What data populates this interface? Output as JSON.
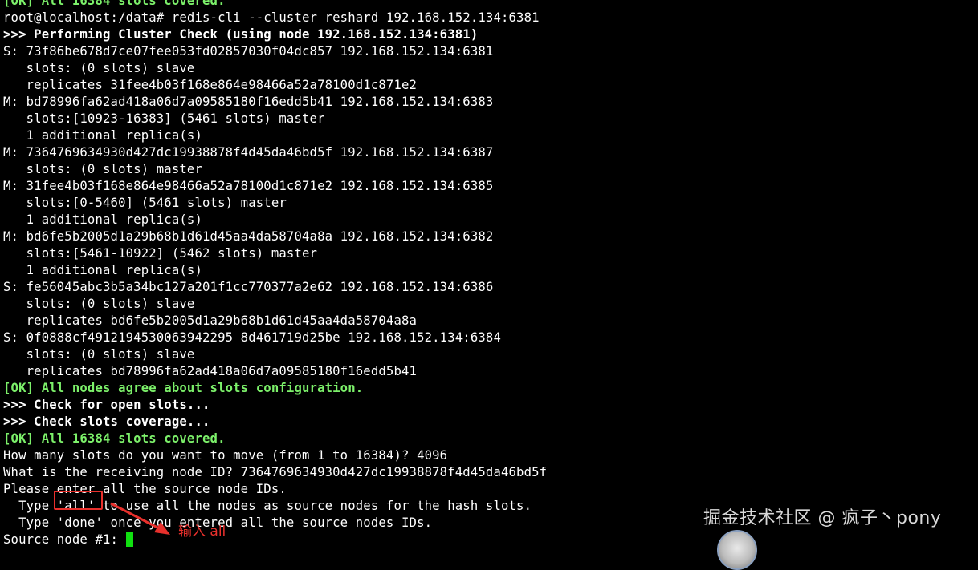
{
  "terminal": {
    "lines": [
      {
        "text": "[OK] All 16384 slots covered.",
        "style": "green"
      },
      {
        "text": "root@localhost:/data# redis-cli --cluster reshard 192.168.152.134:6381",
        "style": "normal"
      },
      {
        "text": ">>> Performing Cluster Check (using node 192.168.152.134:6381)",
        "style": "bold"
      },
      {
        "text": "S: 73f86be678d7ce07fee053fd02857030f04dc857 192.168.152.134:6381",
        "style": "normal"
      },
      {
        "text": "   slots: (0 slots) slave",
        "style": "normal"
      },
      {
        "text": "   replicates 31fee4b03f168e864e98466a52a78100d1c871e2",
        "style": "normal"
      },
      {
        "text": "M: bd78996fa62ad418a06d7a09585180f16edd5b41 192.168.152.134:6383",
        "style": "normal"
      },
      {
        "text": "   slots:[10923-16383] (5461 slots) master",
        "style": "normal"
      },
      {
        "text": "   1 additional replica(s)",
        "style": "normal"
      },
      {
        "text": "M: 7364769634930d427dc19938878f4d45da46bd5f 192.168.152.134:6387",
        "style": "normal"
      },
      {
        "text": "   slots: (0 slots) master",
        "style": "normal"
      },
      {
        "text": "M: 31fee4b03f168e864e98466a52a78100d1c871e2 192.168.152.134:6385",
        "style": "normal"
      },
      {
        "text": "   slots:[0-5460] (5461 slots) master",
        "style": "normal"
      },
      {
        "text": "   1 additional replica(s)",
        "style": "normal"
      },
      {
        "text": "M: bd6fe5b2005d1a29b68b1d61d45aa4da58704a8a 192.168.152.134:6382",
        "style": "normal"
      },
      {
        "text": "   slots:[5461-10922] (5462 slots) master",
        "style": "normal"
      },
      {
        "text": "   1 additional replica(s)",
        "style": "normal"
      },
      {
        "text": "S: fe56045abc3b5a34bc127a201f1cc770377a2e62 192.168.152.134:6386",
        "style": "normal"
      },
      {
        "text": "   slots: (0 slots) slave",
        "style": "normal"
      },
      {
        "text": "   replicates bd6fe5b2005d1a29b68b1d61d45aa4da58704a8a",
        "style": "normal"
      },
      {
        "text": "S: 0f0888cf4912194530063942295 8d461719d25be 192.168.152.134:6384",
        "style": "normal"
      },
      {
        "text": "   slots: (0 slots) slave",
        "style": "normal"
      },
      {
        "text": "   replicates bd78996fa62ad418a06d7a09585180f16edd5b41",
        "style": "normal"
      },
      {
        "text": "[OK] All nodes agree about slots configuration.",
        "style": "green"
      },
      {
        "text": ">>> Check for open slots...",
        "style": "bold"
      },
      {
        "text": ">>> Check slots coverage...",
        "style": "bold"
      },
      {
        "text": "[OK] All 16384 slots covered.",
        "style": "green"
      },
      {
        "text": "How many slots do you want to move (from 1 to 16384)? 4096",
        "style": "normal"
      },
      {
        "text": "What is the receiving node ID? 7364769634930d427dc19938878f4d45da46bd5f",
        "style": "normal"
      },
      {
        "text": "Please enter all the source node IDs.",
        "style": "normal"
      },
      {
        "text": "  Type 'all' to use all the nodes as source nodes for the hash slots.",
        "style": "normal"
      },
      {
        "text": "  Type 'done' once you entered all the source nodes IDs.",
        "style": "normal"
      }
    ],
    "prompt": "Source node #1: "
  },
  "annotation": {
    "text": "输入 all",
    "color": "#e8302c"
  },
  "watermark": {
    "text": "掘金技术社区 @ 疯子丶pony"
  },
  "colors": {
    "background": "#000000",
    "text": "#ffffff",
    "ok_green": "#7cf06a",
    "cursor": "#10e010",
    "highlight": "#e8302c"
  }
}
